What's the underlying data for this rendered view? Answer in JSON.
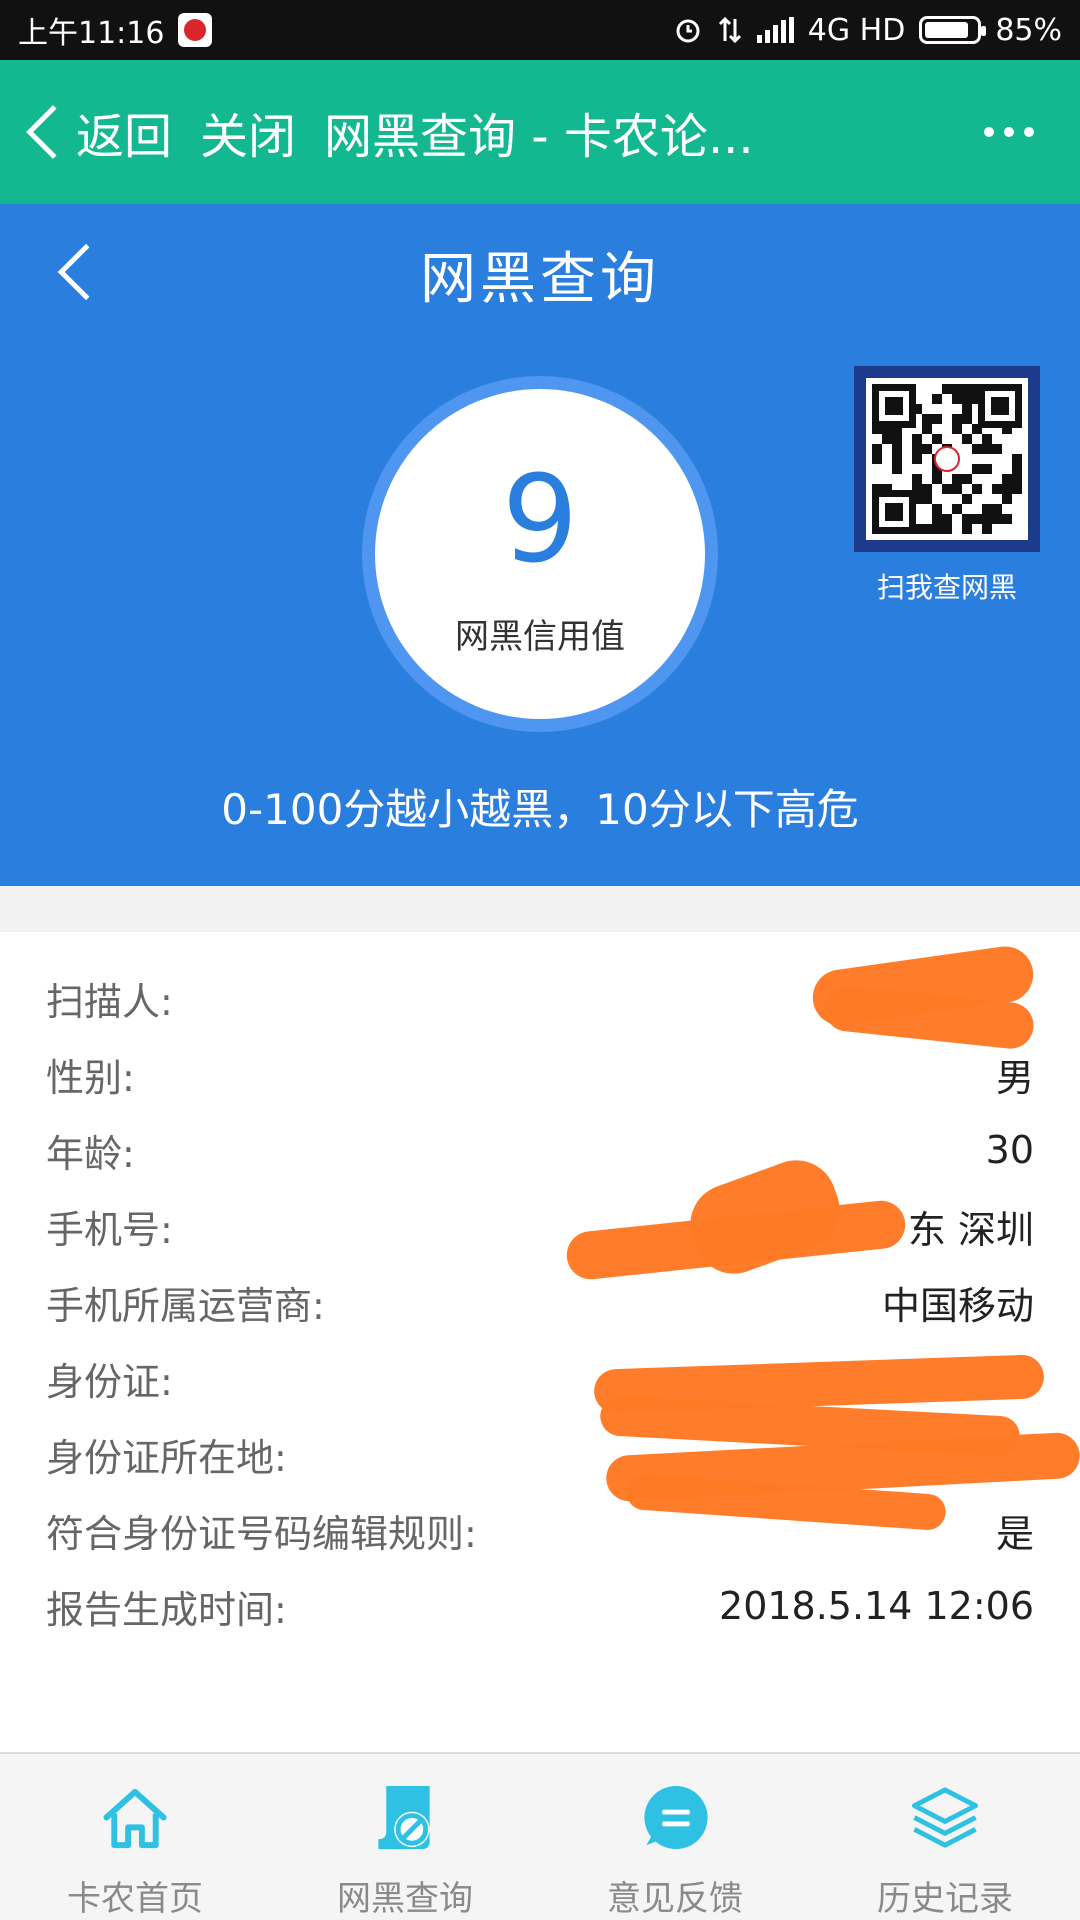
{
  "status_bar": {
    "time": "上午11:16",
    "network": "4G HD",
    "battery": "85%",
    "battery_level": 0.85
  },
  "web_header": {
    "back_label": "返回",
    "close_label": "关闭",
    "title": "网黑查询 - 卡农论..."
  },
  "hero": {
    "title": "网黑查询",
    "score": "9",
    "score_label": "网黑信用值",
    "qr_caption": "扫我查网黑",
    "description": "0-100分越小越黑，10分以下高危"
  },
  "info_rows": [
    {
      "label": "扫描人:",
      "value": ""
    },
    {
      "label": "性别:",
      "value": "男"
    },
    {
      "label": "年龄:",
      "value": "30"
    },
    {
      "label": "手机号:",
      "value": "东 深圳"
    },
    {
      "label": "手机所属运营商:",
      "value": "中国移动"
    },
    {
      "label": "身份证:",
      "value": ""
    },
    {
      "label": "身份证所在地:",
      "value": ""
    },
    {
      "label": "符合身份证号码编辑规则:",
      "value": "是"
    },
    {
      "label": "报告生成时间:",
      "value": "2018.5.14 12:06"
    }
  ],
  "bottom_nav": [
    {
      "label": "卡农首页",
      "icon": "home-icon"
    },
    {
      "label": "网黑查询",
      "icon": "blacklist-search-icon"
    },
    {
      "label": "意见反馈",
      "icon": "feedback-icon"
    },
    {
      "label": "历史记录",
      "icon": "history-layers-icon"
    }
  ],
  "colors": {
    "header_green": "#14b890",
    "hero_blue": "#2a7ede",
    "accent_cyan": "#2ec1e3",
    "redaction_orange": "#ff7a26"
  }
}
